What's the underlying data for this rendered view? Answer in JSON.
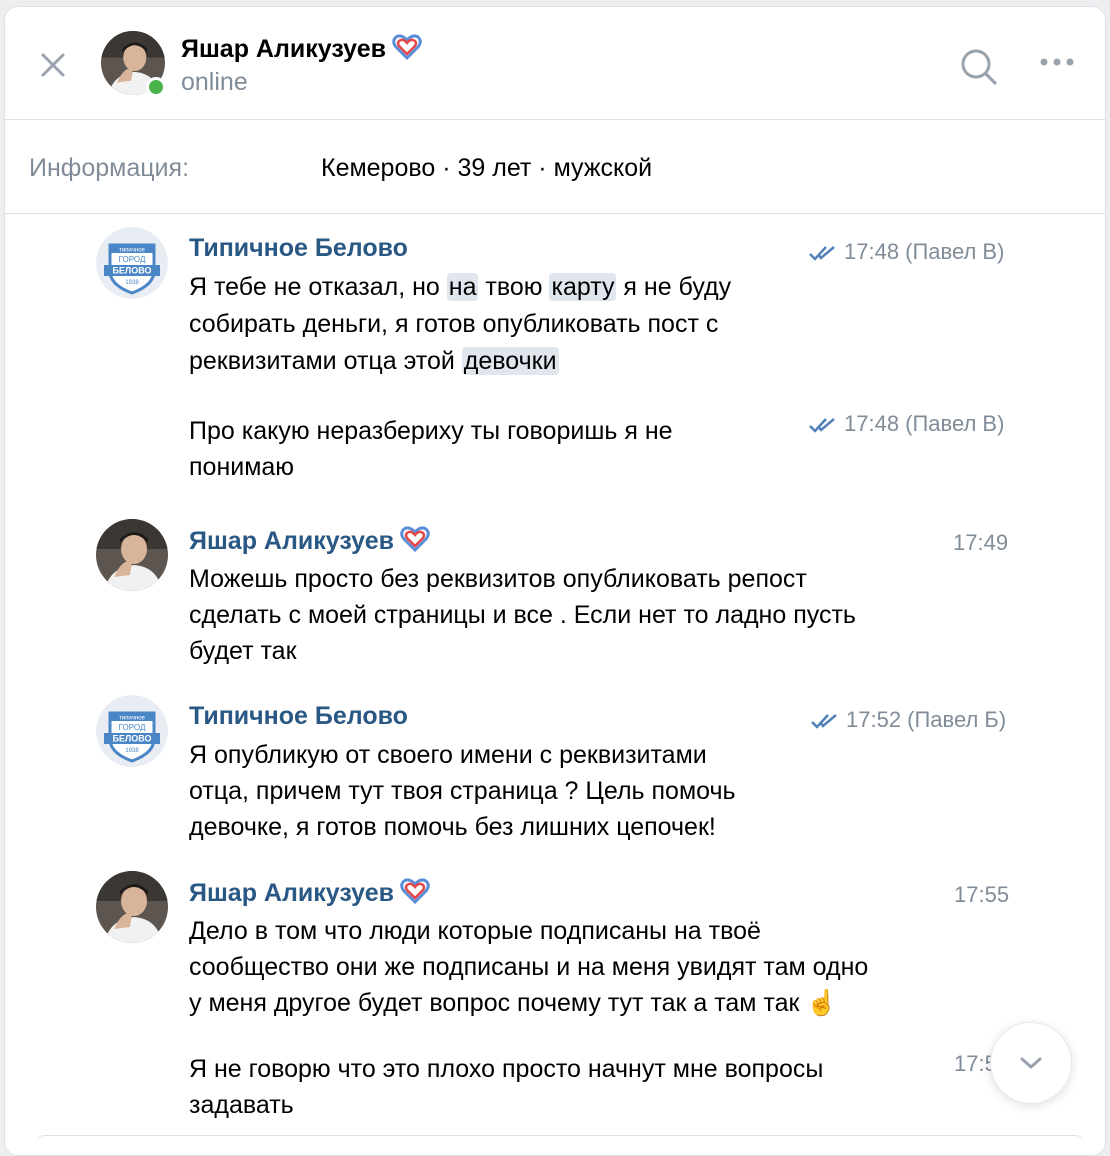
{
  "header": {
    "name": "Яшар Аликузуев",
    "status": "online"
  },
  "info": {
    "label": "Информация:",
    "value": "Кемерово · 39 лет · мужской"
  },
  "messages": [
    {
      "author": "Типичное Белово",
      "avatar_text": [
        "типичное",
        "ГОРОД",
        "БЕЛОВО",
        "1938"
      ],
      "time": "17:48 (Павел В)",
      "lines": [
        [
          "Я тебе не отказал, но ",
          "на",
          " твою ",
          "карту",
          " я не буду"
        ],
        "собирать деньги, я готов опубликовать пост с",
        [
          "реквизитами отца этой ",
          "девочки"
        ]
      ]
    },
    {
      "time": "17:48 (Павел В)",
      "lines": [
        "Про какую неразбериху ты говоришь я не",
        "понимаю"
      ]
    },
    {
      "author": "Яшар Аликузуев",
      "time": "17:49",
      "lines": [
        "Можешь просто без реквизитов опубликовать репост",
        "сделать с моей страницы и все . Если нет то ладно пусть",
        "будет так"
      ]
    },
    {
      "author": "Типичное Белово",
      "avatar_text": [
        "типичное",
        "ГОРОД",
        "БЕЛОВО",
        "1938"
      ],
      "time": "17:52 (Павел Б)",
      "lines": [
        "Я опубликую от своего имени с реквизитами",
        "отца, причем тут твоя страница ? Цель помочь",
        "девочке, я готов помочь без лишних цепочек!"
      ]
    },
    {
      "author": "Яшар Аликузуев",
      "time": "17:55",
      "lines": [
        "Дело в том что люди которые подписаны на твоё",
        "сообщество они же подписаны и на меня увидят там одно",
        "у меня другое будет вопрос почему тут так а там так ☝️"
      ]
    },
    {
      "time": "17:5",
      "lines": [
        "Я не говорю что это плохо просто начнут мне вопросы",
        "задавать"
      ]
    }
  ],
  "icons": {
    "close": "close-icon",
    "search": "search-icon",
    "more": "more-icon",
    "read": "double-check-icon",
    "scroll": "chevron-down-icon",
    "heart": "heart-icon"
  },
  "colors": {
    "author": "#2a5885",
    "secondary": "#818c99",
    "online": "#4bb34b",
    "read_ticks": "#5181b8",
    "highlight": "#dfe6ee"
  }
}
